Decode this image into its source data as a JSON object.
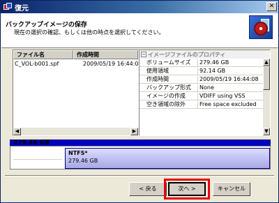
{
  "window": {
    "title": "復元"
  },
  "header": {
    "title": "バックアップイメージの保存",
    "description": "現在の選択の確認、もしくは他の時点を選択してください。"
  },
  "file_list": {
    "columns": [
      "ファイル名",
      "作成時間"
    ],
    "rows": [
      {
        "name": "C_VOL-b001.spf",
        "time": "2009/05/19 16:44:08"
      }
    ]
  },
  "properties": {
    "header": "イメージファイルのプロパティ",
    "rows": [
      {
        "key": "ボリュームサイズ",
        "value": "279.46 GB"
      },
      {
        "key": "使用領域",
        "value": "92.14 GB"
      },
      {
        "key": "作成時間",
        "value": "2009/05/19 16:44:08"
      },
      {
        "key": "バックアップ形式",
        "value": "None"
      },
      {
        "key": "イメージの作成",
        "value": "VDIFF using VSS"
      },
      {
        "key": "空き領域の除外",
        "value": "Free space excluded"
      }
    ]
  },
  "disk": {
    "size_label": "279.46 GB",
    "partition_name": "NTFS*",
    "partition_size": "279.46 GB"
  },
  "buttons": {
    "back": "< 戻る",
    "next": "次へ >",
    "cancel": "キャンセル"
  },
  "colors": {
    "title_bar": "#0a246a",
    "disk_bar": "#0000c0",
    "highlight": "#e8000b"
  }
}
